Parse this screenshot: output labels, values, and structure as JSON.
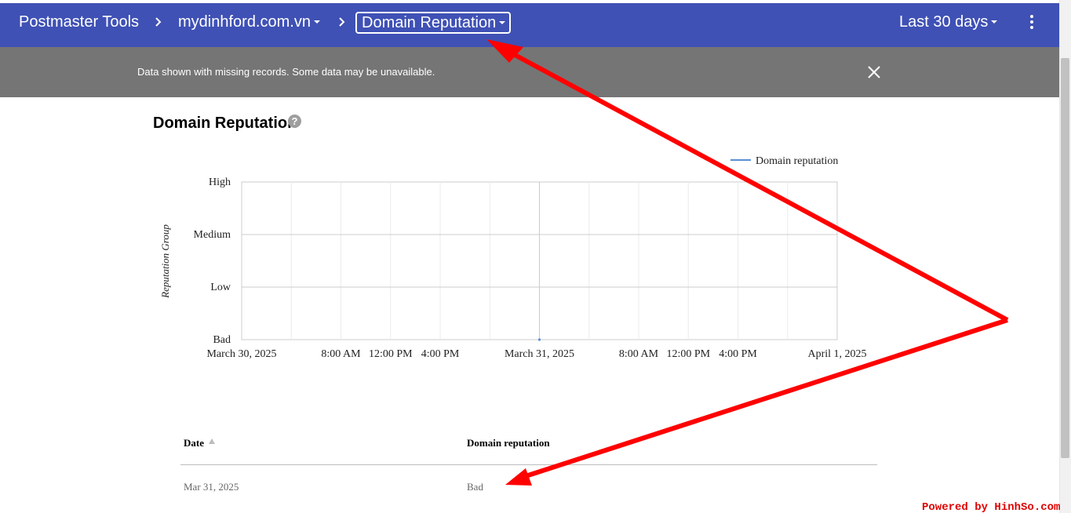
{
  "header": {
    "app_title": "Postmaster Tools",
    "domain": "mydinhford.com.vn",
    "current_page": "Domain Reputation",
    "date_range": "Last 30 days",
    "more_icon": "more-vert-icon",
    "background": "#3f51b5"
  },
  "banner": {
    "message": "Data shown with missing records. Some data may be unavailable.",
    "close_icon": "close-icon",
    "background": "#757575"
  },
  "section": {
    "title": "Domain Reputation",
    "help_icon": "help-icon",
    "help_glyph": "?"
  },
  "chart_data": {
    "type": "line",
    "title": "",
    "xlabel": "",
    "ylabel": "Reputation Group",
    "y_categories": [
      "Bad",
      "Low",
      "Medium",
      "High"
    ],
    "x_tick_labels": [
      "March 30, 2025",
      "8:00 AM",
      "12:00 PM",
      "4:00 PM",
      "March 31, 2025",
      "8:00 AM",
      "12:00 PM",
      "4:00 PM",
      "April 1, 2025"
    ],
    "series": [
      {
        "name": "Domain reputation",
        "color": "#5b8fd6",
        "points": [
          {
            "x": "March 31, 2025",
            "y": "Bad"
          }
        ]
      }
    ],
    "legend_position": "top-right",
    "grid": true
  },
  "table": {
    "columns": [
      "Date",
      "Domain reputation"
    ],
    "sort_icon": "sort-ascending-icon",
    "rows": [
      [
        "Mar 31, 2025",
        "Bad"
      ]
    ]
  },
  "watermark": "Powered by HinhSo.com",
  "annotation_color": "#ff0000"
}
